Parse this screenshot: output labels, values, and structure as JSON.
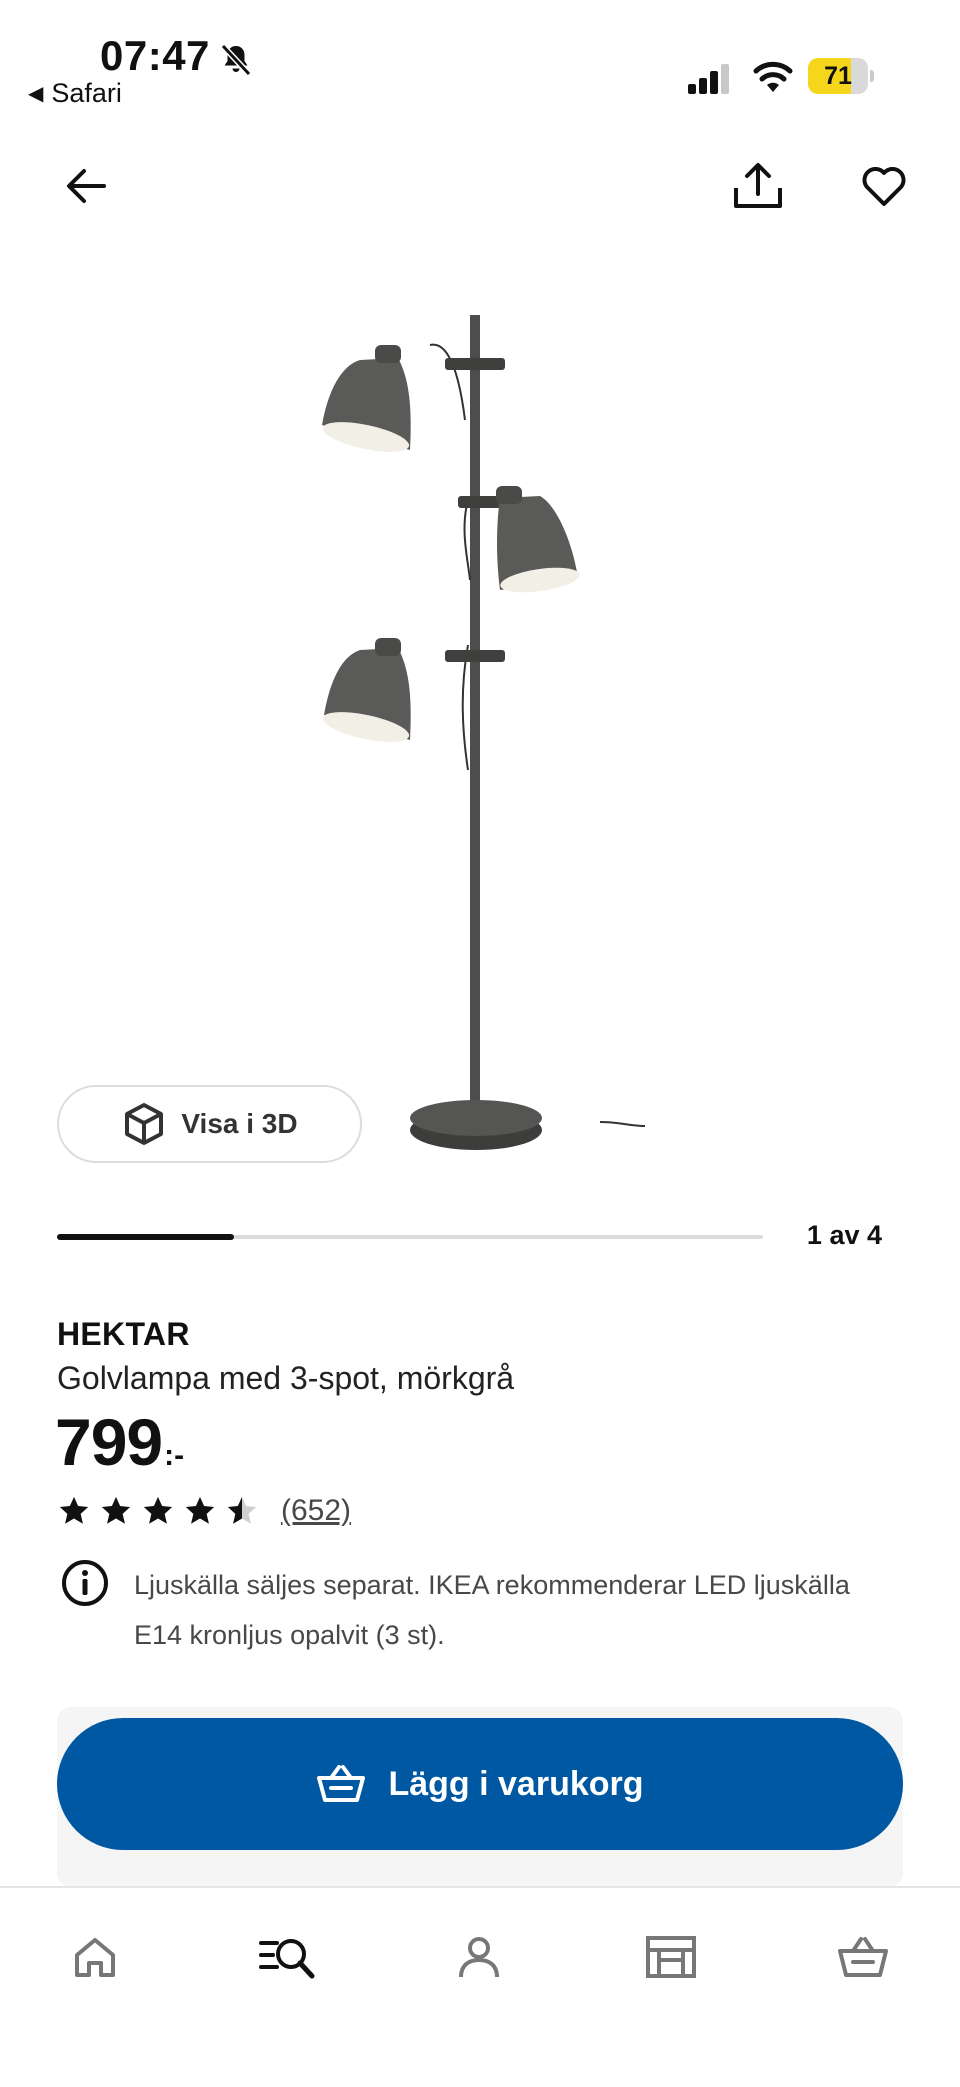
{
  "status_bar": {
    "time": "07:47",
    "back_app": "Safari",
    "battery_level": "71",
    "battery_fraction": 0.71
  },
  "header": {
    "back_icon": "arrow-left-icon",
    "share_icon": "share-icon",
    "favorite_icon": "heart-icon"
  },
  "gallery": {
    "view_3d_label": "Visa i 3D",
    "counter": "1 av 4",
    "current": 1,
    "total": 4
  },
  "product": {
    "name": "HEKTAR",
    "description": "Golvlampa med 3-spot, mörkgrå",
    "price": "799",
    "price_suffix": ":-",
    "rating": 4.5,
    "rating_max": 5,
    "review_count": "(652)",
    "info_text": "Ljuskälla säljes separat. IKEA rekommenderar LED ljuskälla E14 kronljus opalvit (3 st)."
  },
  "cta": {
    "add_to_cart_label": "Lägg i varukorg",
    "color": "#0058a3"
  },
  "tabbar": {
    "items": [
      "home-icon",
      "search-icon",
      "profile-icon",
      "store-icon",
      "cart-icon"
    ],
    "active": "search-icon"
  }
}
